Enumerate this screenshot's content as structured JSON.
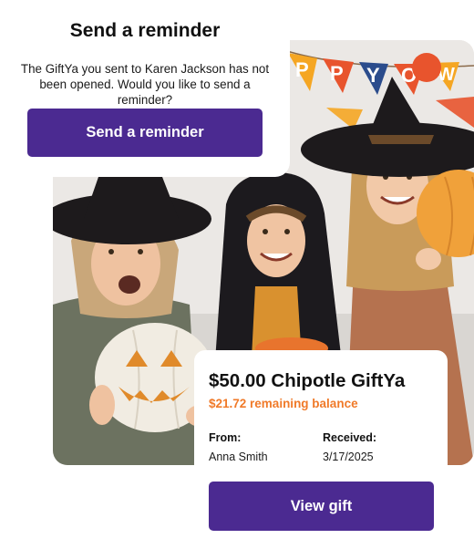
{
  "reminder": {
    "title": "Send a reminder",
    "message": "The GiftYa you sent to Karen Jackson has not been opened. Would you like to send a reminder?",
    "button_label": "Send a reminder"
  },
  "photo": {
    "banner_letters": [
      "P",
      "P",
      "Y",
      "O",
      "W"
    ],
    "banner_colors": [
      "#f5a623",
      "#e8542d",
      "#2b4c8c",
      "#e8542d",
      "#f5a623"
    ]
  },
  "gift": {
    "title": "$50.00 Chipotle GiftYa",
    "balance": "$21.72 remaining balance",
    "from_label": "From:",
    "from_value": "Anna Smith",
    "received_label": "Received:",
    "received_value": "3/17/2025"
  },
  "actions": {
    "view_label": "View gift"
  },
  "colors": {
    "primary": "#4b2a91",
    "accent": "#f07a29"
  }
}
